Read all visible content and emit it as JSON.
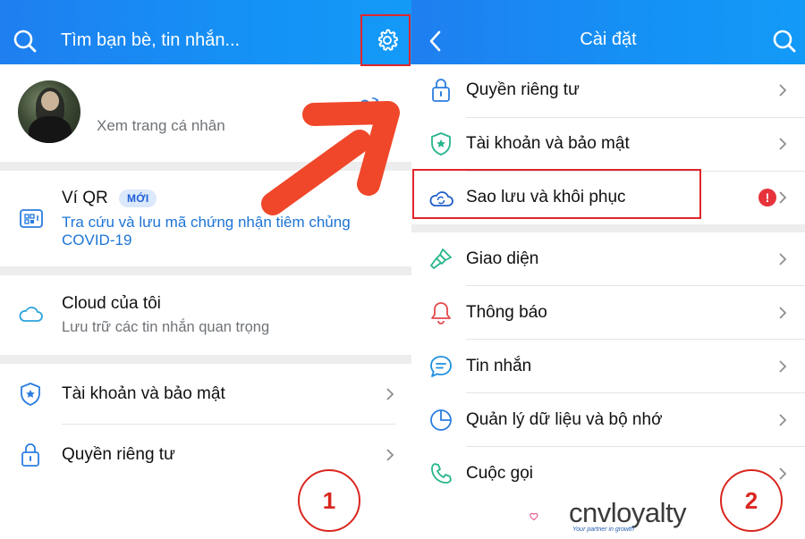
{
  "left": {
    "search": {
      "placeholder": "Tìm bạn bè, tin nhắn..."
    },
    "profile": {
      "link_label": "Xem trang cá nhân"
    },
    "qr": {
      "title": "Ví QR",
      "badge": "MỚI",
      "subtitle_line1": "Tra cứu và lưu mã chứng nhận tiêm chủng",
      "subtitle_line2": "COVID-19"
    },
    "cloud": {
      "title": "Cloud của tôi",
      "subtitle": "Lưu trữ các tin nhắn quan trọng"
    },
    "items": [
      {
        "label": "Tài khoản và bảo mật",
        "icon": "shield-icon"
      },
      {
        "label": "Quyền riêng tư",
        "icon": "lock-icon"
      }
    ],
    "step_number": "1"
  },
  "right": {
    "header": {
      "title": "Cài đặt"
    },
    "items": [
      {
        "label": "Quyền riêng tư",
        "icon": "lock-icon"
      },
      {
        "label": "Tài khoản và bảo mật",
        "icon": "shield-icon"
      },
      {
        "label": "Sao lưu và khôi phục",
        "icon": "cloud-sync-icon",
        "alert": "!"
      },
      {
        "label": "Giao diện",
        "icon": "brush-icon"
      },
      {
        "label": "Thông báo",
        "icon": "bell-icon"
      },
      {
        "label": "Tin nhắn",
        "icon": "chat-icon"
      },
      {
        "label": "Quản lý dữ liệu và bộ nhớ",
        "icon": "pie-chart-icon"
      },
      {
        "label": "Cuộc gọi",
        "icon": "phone-icon"
      }
    ],
    "step_number": "2"
  },
  "watermark": {
    "brand": "cnvloyalty",
    "tagline": "Your partner in growth"
  },
  "colors": {
    "header_blue": "#1a8cf3",
    "highlight_red": "#e0262c",
    "arrow_orange": "#f0472a",
    "link_blue": "#1d74d6"
  }
}
